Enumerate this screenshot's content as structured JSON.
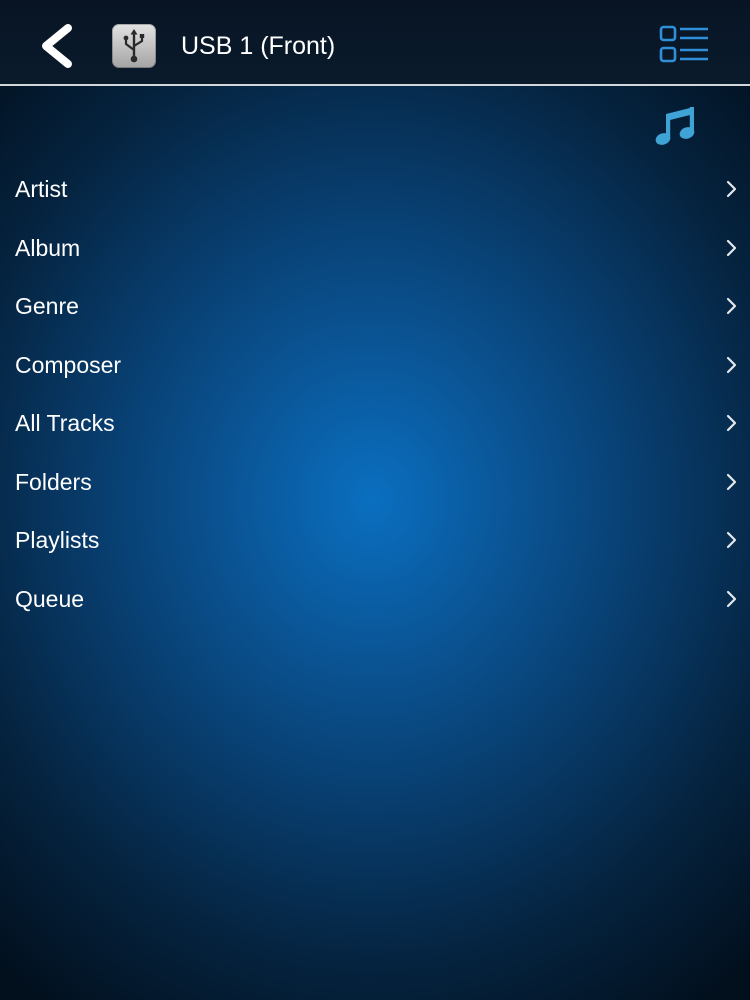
{
  "header": {
    "title": "USB 1 (Front)",
    "back_icon": "chevron-left-icon",
    "source_icon": "usb-icon",
    "view_toggle_icon": "list-view-icon"
  },
  "content": {
    "media_type_icon": "music-note-icon",
    "menu_items": [
      {
        "label": "Artist"
      },
      {
        "label": "Album"
      },
      {
        "label": "Genre"
      },
      {
        "label": "Composer"
      },
      {
        "label": "All Tracks"
      },
      {
        "label": "Folders"
      },
      {
        "label": "Playlists"
      },
      {
        "label": "Queue"
      }
    ]
  },
  "colors": {
    "accent": "#2f8fd8",
    "music_icon": "#3fa3d6",
    "divider": "#d2d7dc",
    "text": "#ffffff"
  }
}
